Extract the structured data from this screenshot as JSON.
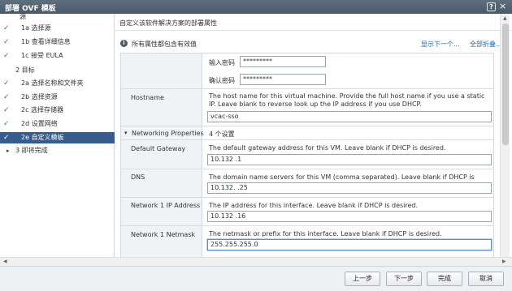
{
  "window": {
    "title": "部署 OVF 模板",
    "help_label": "?",
    "close_label": "×"
  },
  "sidebar": {
    "items": [
      {
        "check": "",
        "label": "源",
        "selected": false
      },
      {
        "check": "✓",
        "label": "1a 选择源",
        "selected": false
      },
      {
        "check": "✓",
        "label": "1b 查看详细信息",
        "selected": false
      },
      {
        "check": "✓",
        "label": "1c 接受 EULA",
        "selected": false
      },
      {
        "check": "",
        "label": "2 目标",
        "selected": false
      },
      {
        "check": "✓",
        "label": "2a 选择名称和文件夹",
        "selected": false
      },
      {
        "check": "✓",
        "label": "2b 选择资源",
        "selected": false
      },
      {
        "check": "✓",
        "label": "2c 选择存储器",
        "selected": false
      },
      {
        "check": "✓",
        "label": "2d 设置网络",
        "selected": false
      },
      {
        "check": "✓",
        "label": "2e 自定义模板",
        "selected": true
      },
      {
        "check": "▸",
        "label": "3 即将完成",
        "selected": false
      }
    ]
  },
  "main": {
    "header": "自定义该软件解决方案的部署属性",
    "info_icon": "i",
    "info_text": "所有属性都包含有效值",
    "show_next_link": "显示下一个...",
    "collapse_all_link": "全部折叠...",
    "password": {
      "label": "输入密码",
      "value": "*********"
    },
    "confirm_password": {
      "label": "确认密码",
      "value": "*********"
    },
    "hostname": {
      "label": "Hostname",
      "desc": "The host name for this virtual machine. Provide the full host name if you use a static IP. Leave blank to reverse look up the IP address if you use DHCP.",
      "value": "vcac-sso"
    },
    "networking": {
      "caret": "▾",
      "label": "Networking Properties",
      "count": "4 个设置"
    },
    "gateway": {
      "label": "Default Gateway",
      "desc": "The default gateway address for this VM. Leave blank if DHCP is desired.",
      "value": "10.132    .1"
    },
    "dns": {
      "label": "DNS",
      "desc": "The domain name servers for this VM (comma separated). Leave blank if DHCP is desired.",
      "value": "10.132.     .25"
    },
    "ip": {
      "label": "Network 1 IP Address",
      "desc": "The IP address for this interface. Leave blank if DHCP is desired.",
      "value": "10.132     .16"
    },
    "netmask": {
      "label": "Network 1 Netmask",
      "desc": "The netmask or prefix for this interface. Leave blank if DHCP is desired.",
      "value": "255.255.255.0"
    }
  },
  "footer": {
    "back": "上一步",
    "next": "下一步",
    "finish": "完成",
    "cancel": "取消"
  }
}
